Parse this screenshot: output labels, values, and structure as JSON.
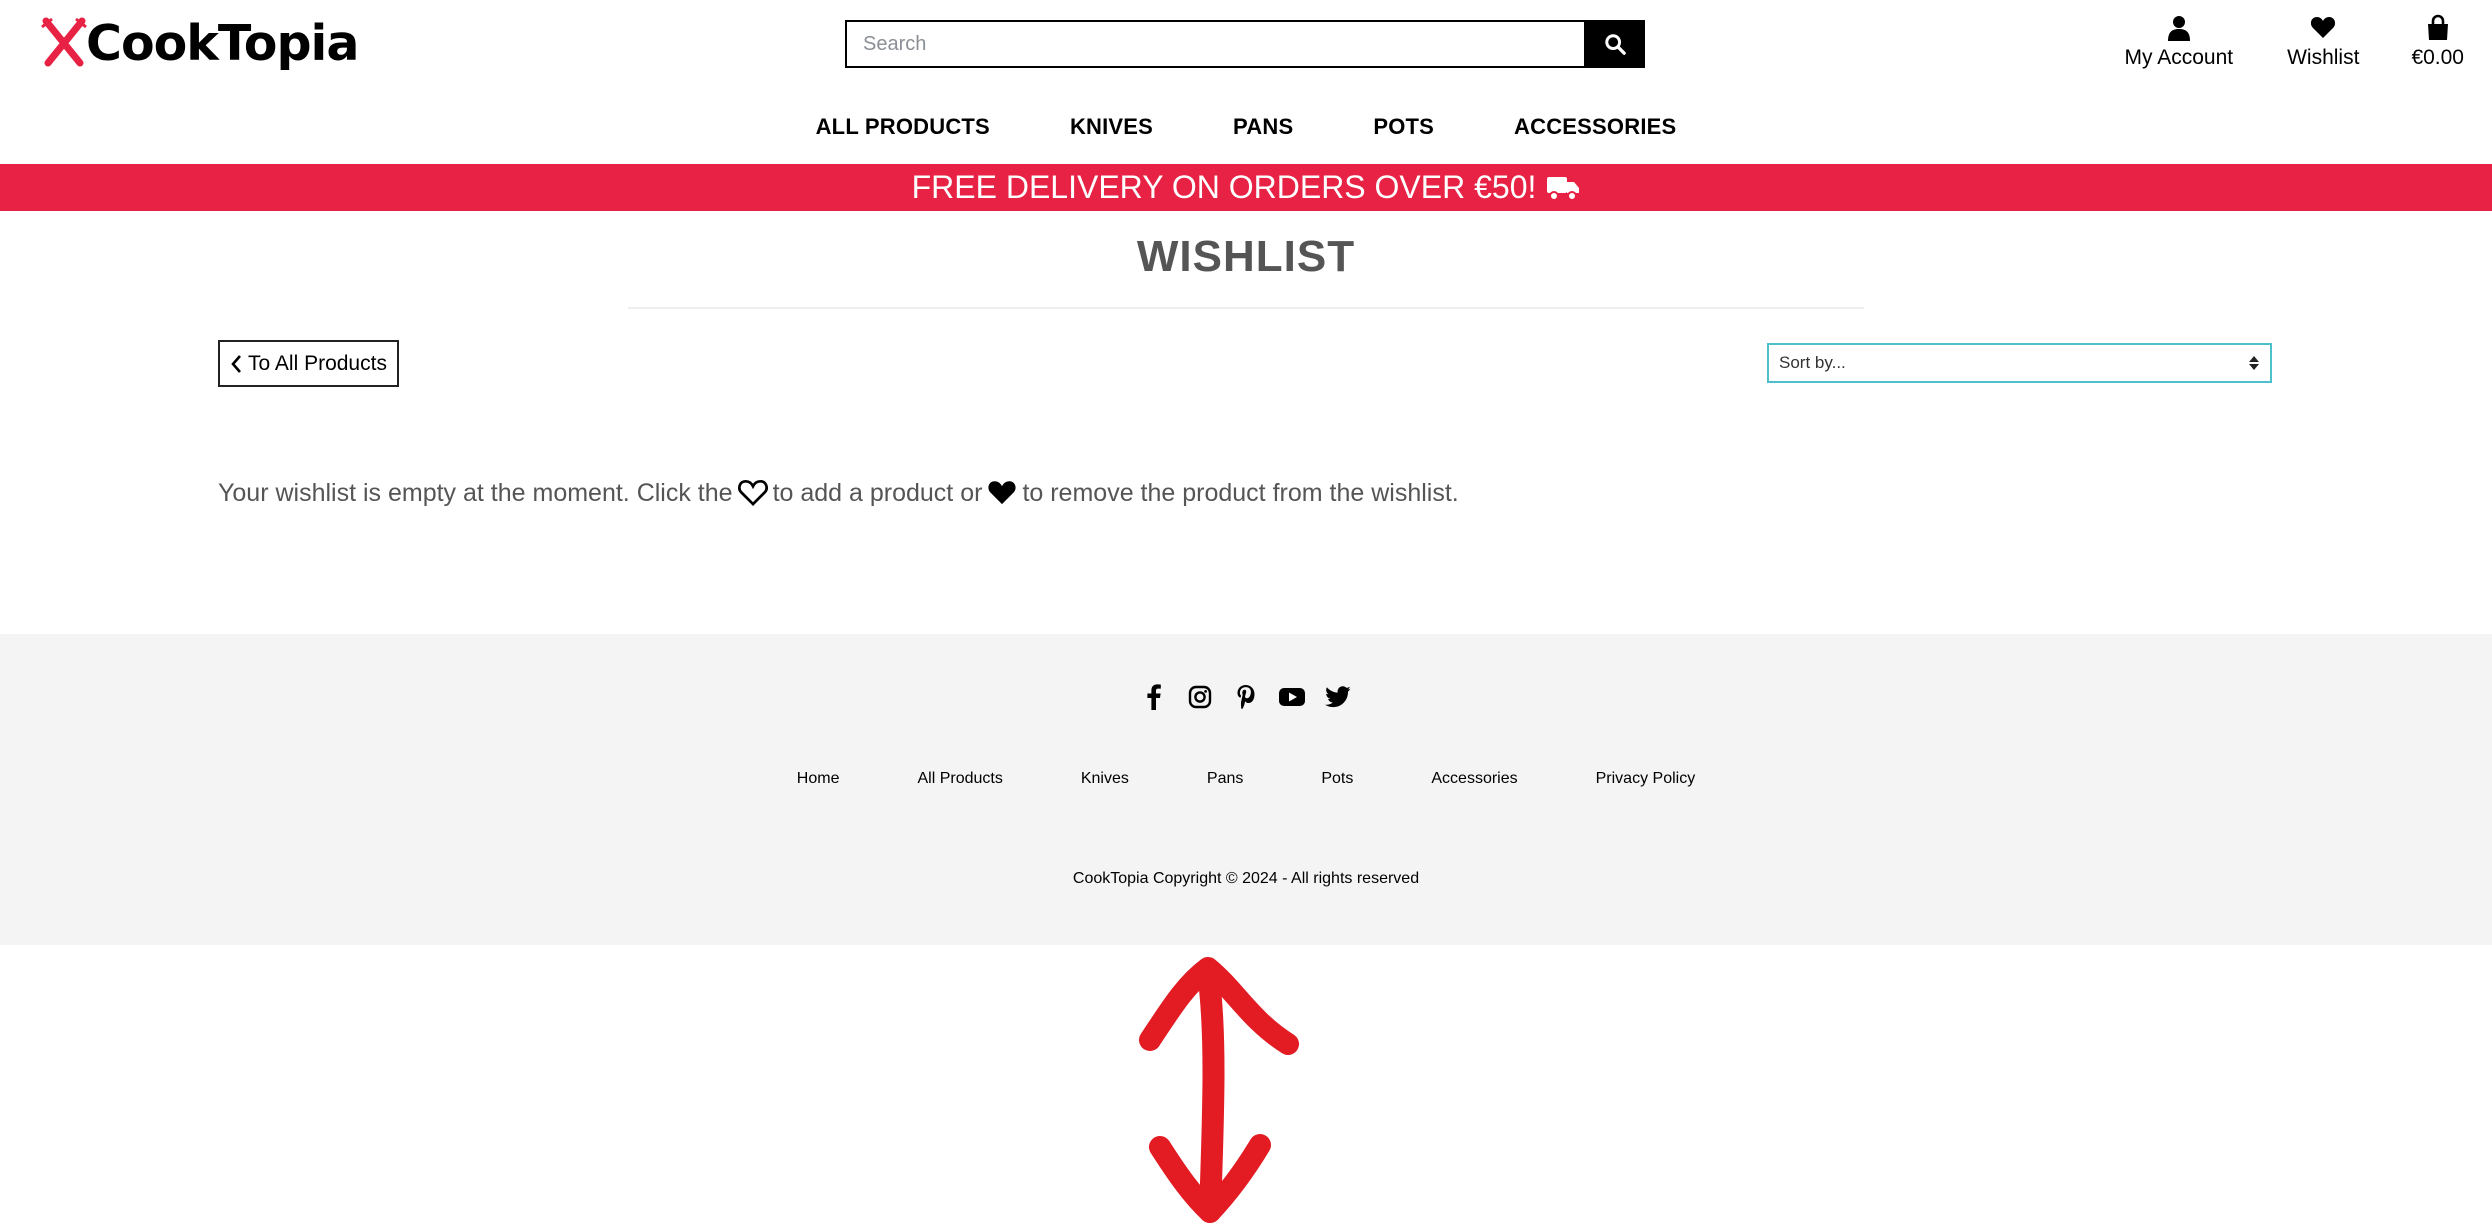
{
  "brand": {
    "name": "CookTopia",
    "accent": "#e82244"
  },
  "search": {
    "placeholder": "Search",
    "icon": "search-icon"
  },
  "header_links": {
    "account": {
      "label": "My Account",
      "icon": "user-icon"
    },
    "wishlist": {
      "label": "Wishlist",
      "icon": "heart-icon"
    },
    "bag": {
      "label": "€0.00",
      "icon": "shopping-bag-icon"
    }
  },
  "nav": [
    "ALL PRODUCTS",
    "KNIVES",
    "PANS",
    "POTS",
    "ACCESSORIES"
  ],
  "banner": {
    "text": "FREE DELIVERY ON ORDERS OVER €50!",
    "icon": "truck-icon"
  },
  "page": {
    "title": "WISHLIST",
    "back_label": "To All Products",
    "sort_label": "Sort by...",
    "empty_parts": [
      "Your wishlist is empty at the moment. Click the",
      "to add a product or",
      "to remove the product from the wishlist."
    ]
  },
  "footer": {
    "social": [
      "facebook-icon",
      "instagram-icon",
      "pinterest-icon",
      "youtube-icon",
      "twitter-icon"
    ],
    "links": [
      "Home",
      "All Products",
      "Knives",
      "Pans",
      "Pots",
      "Accessories",
      "Privacy Policy"
    ],
    "copyright": "CookTopia Copyright © 2024 - All rights reserved"
  },
  "annotation": {
    "icon": "red-double-arrow-icon",
    "color": "#e31b23"
  }
}
